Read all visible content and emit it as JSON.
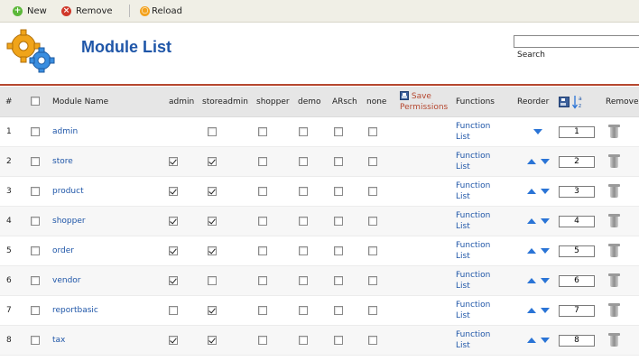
{
  "toolbar": {
    "new_label": "New",
    "remove_label": "Remove",
    "reload_label": "Reload"
  },
  "header": {
    "title": "Module List",
    "search_value": "",
    "search_label": "Search"
  },
  "table": {
    "columns": {
      "num": "#",
      "name": "Module Name",
      "admin": "admin",
      "storeadmin": "storeadmin",
      "shopper": "shopper",
      "demo": "demo",
      "arsch": "ARsch",
      "none": "none",
      "save_line1": "Save",
      "save_line2": "Permissions",
      "functions": "Functions",
      "reorder": "Reorder",
      "remove": "Remove"
    },
    "function_list_line1": "Function",
    "function_list_line2": "List",
    "rows": [
      {
        "num": "1",
        "name": "admin",
        "admin": false,
        "storeadmin": false,
        "shopper": false,
        "demo": false,
        "arsch": false,
        "none": false,
        "order": "1",
        "has_up": false,
        "admin_shown": false
      },
      {
        "num": "2",
        "name": "store",
        "admin": true,
        "storeadmin": true,
        "shopper": false,
        "demo": false,
        "arsch": false,
        "none": false,
        "order": "2",
        "has_up": true,
        "admin_shown": true
      },
      {
        "num": "3",
        "name": "product",
        "admin": true,
        "storeadmin": true,
        "shopper": false,
        "demo": false,
        "arsch": false,
        "none": false,
        "order": "3",
        "has_up": true,
        "admin_shown": true
      },
      {
        "num": "4",
        "name": "shopper",
        "admin": true,
        "storeadmin": true,
        "shopper": false,
        "demo": false,
        "arsch": false,
        "none": false,
        "order": "4",
        "has_up": true,
        "admin_shown": true
      },
      {
        "num": "5",
        "name": "order",
        "admin": true,
        "storeadmin": true,
        "shopper": false,
        "demo": false,
        "arsch": false,
        "none": false,
        "order": "5",
        "has_up": true,
        "admin_shown": true
      },
      {
        "num": "6",
        "name": "vendor",
        "admin": true,
        "storeadmin": false,
        "shopper": false,
        "demo": false,
        "arsch": false,
        "none": false,
        "order": "6",
        "has_up": true,
        "admin_shown": true
      },
      {
        "num": "7",
        "name": "reportbasic",
        "admin": false,
        "storeadmin": true,
        "shopper": false,
        "demo": false,
        "arsch": false,
        "none": false,
        "order": "7",
        "has_up": true,
        "admin_shown": true
      },
      {
        "num": "8",
        "name": "tax",
        "admin": true,
        "storeadmin": true,
        "shopper": false,
        "demo": false,
        "arsch": false,
        "none": false,
        "order": "8",
        "has_up": true,
        "admin_shown": true
      }
    ]
  },
  "colors": {
    "link": "#1f56a8",
    "accent_rule": "#b5472f",
    "arrow": "#2a74d6"
  }
}
